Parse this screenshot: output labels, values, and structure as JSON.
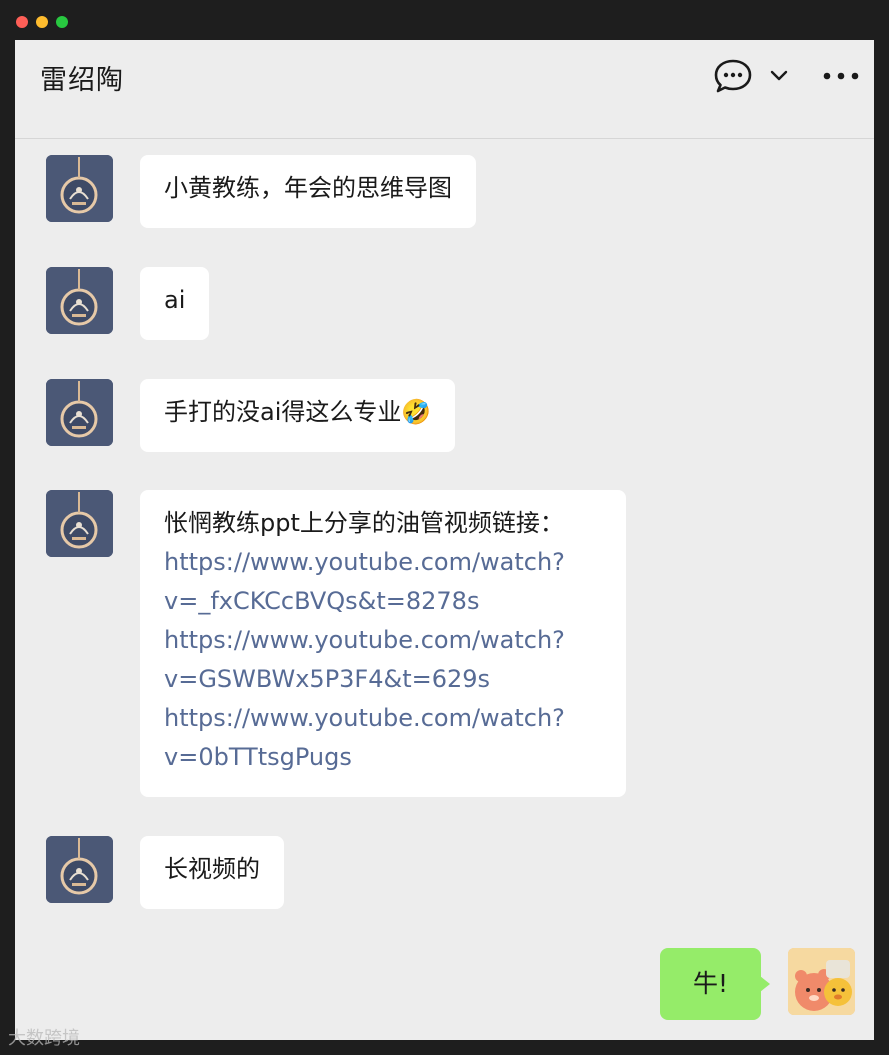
{
  "chat": {
    "title": "雷绍陶",
    "header_icons": [
      "chat-bubble-icon",
      "chevron-down-icon",
      "more-icon"
    ]
  },
  "messages": [
    {
      "sender": "contact",
      "text": "小黄教练，年会的思维导图"
    },
    {
      "sender": "contact",
      "text": "ai"
    },
    {
      "sender": "contact",
      "text": "手打的没ai得这么专业",
      "emoji": "🤣"
    },
    {
      "sender": "contact",
      "text": "怅惘教练ppt上分享的油管视频链接：",
      "links": [
        {
          "line1": "https://www.youtube.com/watch?",
          "line2": "v=_fxCKCcBVQs&t=8278s"
        },
        {
          "line1": "https://www.youtube.com/watch?",
          "line2": "v=GSWBWx5P3F4&t=629s"
        },
        {
          "line1": "https://www.youtube.com/watch?",
          "line2": "v=0bTTtsgPugs"
        }
      ]
    },
    {
      "sender": "contact",
      "text": "长视频的"
    },
    {
      "sender": "self",
      "text": "牛!"
    }
  ],
  "watermark": {
    "text": "大数跨境"
  },
  "colors": {
    "window_bg": "#1e1e1e",
    "chat_bg": "#ededed",
    "bubble_in": "#ffffff",
    "bubble_out": "#95ec69",
    "link": "#576b95"
  }
}
